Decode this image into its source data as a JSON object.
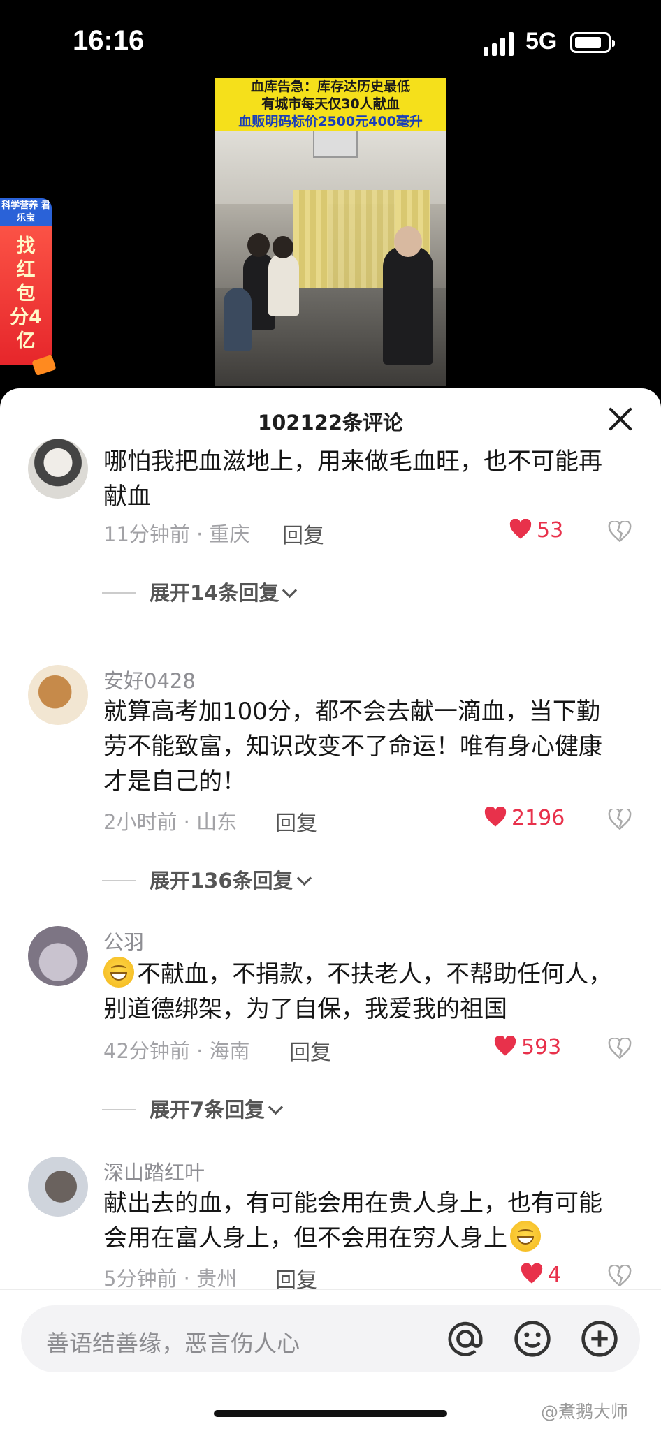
{
  "status_bar": {
    "time": "16:16",
    "network": "5G",
    "battery_level": 0.85
  },
  "video": {
    "caption_lines": [
      "血库告急：库存达历史最低",
      "有城市每天仅30人献血",
      "血贩明码标价2500元400毫升"
    ]
  },
  "promo": {
    "badge": "科学营养 君乐宝",
    "text": "找红包分4亿"
  },
  "sheet": {
    "title": "102122条评论"
  },
  "comments": [
    {
      "username": "",
      "text": "哪怕我把血滋地上，用来做毛血旺，也不可能再献血",
      "time": "11分钟前 · 重庆",
      "reply_label": "回复",
      "likes": "53",
      "expand_label": "展开14条回复"
    },
    {
      "username": "安好0428",
      "text": "就算高考加100分，都不会去献一滴血，当下勤劳不能致富，知识改变不了命运！唯有身心健康才是自己的！",
      "time": "2小时前 · 山东",
      "reply_label": "回复",
      "likes": "2196",
      "expand_label": "展开136条回复"
    },
    {
      "username": "公羽",
      "text": "不献血，不捐款，不扶老人，不帮助任何人，别道德绑架，为了自保，我爱我的祖国",
      "time": "42分钟前 · 海南",
      "reply_label": "回复",
      "likes": "593",
      "expand_label": "展开7条回复"
    },
    {
      "username": "深山踏红叶",
      "text": "献出去的血，有可能会用在贵人身上，也有可能会用在富人身上，但不会用在穷人身上",
      "time": "5分钟前 · 贵州",
      "reply_label": "回复",
      "likes": "4"
    }
  ],
  "input": {
    "placeholder": "善语结善缘，恶言伤人心"
  },
  "icons": {
    "mention": "at-icon",
    "emoji": "smiley-icon",
    "add": "plus-circle-icon",
    "like": "heart-icon",
    "dislike": "broken-heart-icon",
    "close": "close-icon"
  },
  "colors": {
    "like_red": "#e8314b",
    "caption_yellow": "#f5e01b",
    "caption_blue": "#1a3fb8",
    "promo_red": "#e6262b"
  },
  "watermark": "@煮鹅大师"
}
